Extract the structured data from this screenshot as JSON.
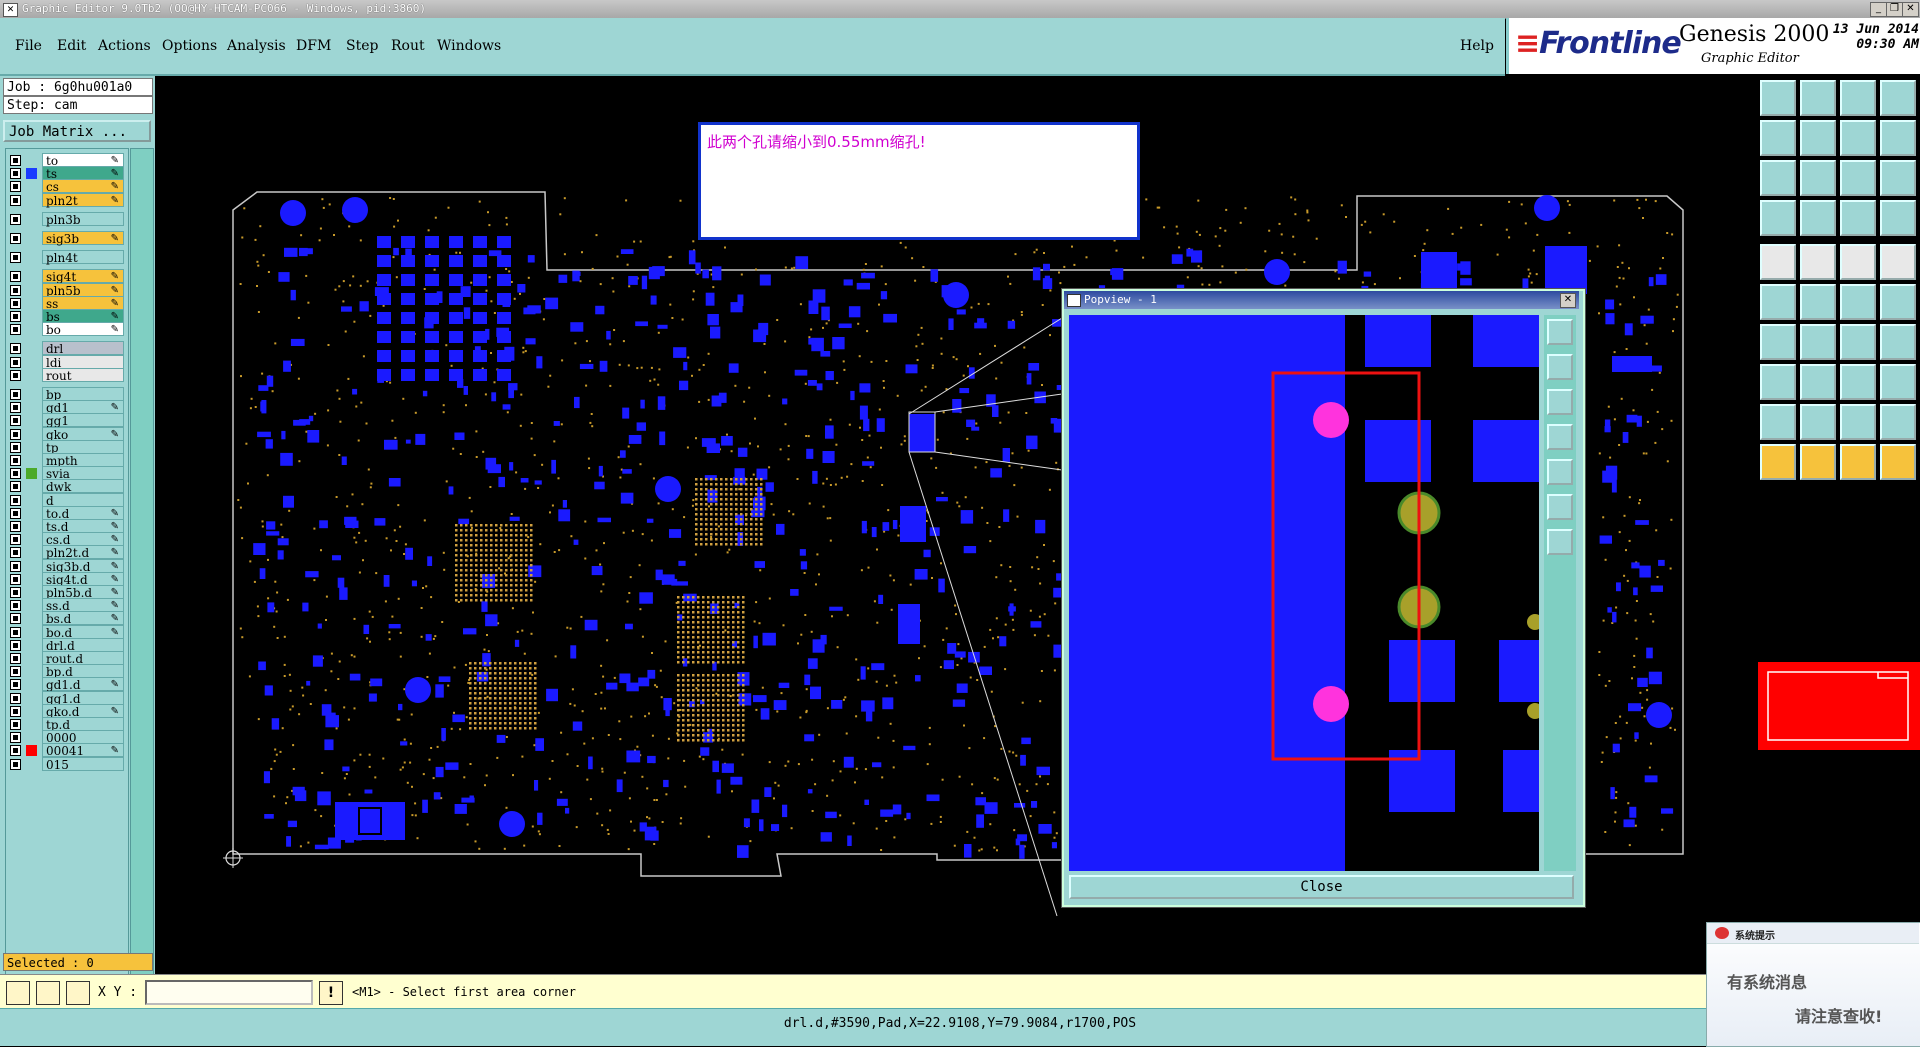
{
  "window": {
    "title": "Graphic Editor 9.0Tb2 (OO@HY-HTCAM-PC066 - Windows, pid:3860)"
  },
  "menu": {
    "items": [
      "File",
      "Edit",
      "Actions",
      "Options",
      "Analysis",
      "DFM",
      "Step",
      "Rout",
      "Windows"
    ],
    "help": "Help"
  },
  "brand": {
    "logo": "Frontline",
    "product": "Genesis 2000",
    "subtitle": "Graphic Editor",
    "date": "13 Jun 2014",
    "time": "09:30 AM"
  },
  "job": {
    "job_label": "Job : 6g0hu001a0",
    "step_label": "Step: cam",
    "matrix_button": "Job Matrix ..."
  },
  "layers": [
    {
      "name": "to",
      "bg": "#ffffff",
      "swatch": "",
      "pen": true
    },
    {
      "name": "ts",
      "bg": "#3fa88c",
      "swatch": "#1a3cff",
      "pen": true
    },
    {
      "name": "cs",
      "bg": "#f6c23c",
      "swatch": "",
      "pen": true
    },
    {
      "name": "pln2t",
      "bg": "#f6c23c",
      "swatch": "",
      "pen": true
    },
    {
      "name": "pln3b",
      "bg": "#9ed6d4",
      "swatch": "",
      "pen": false
    },
    {
      "name": "sig3b",
      "bg": "#f6c23c",
      "swatch": "",
      "pen": true
    },
    {
      "name": "pln4t",
      "bg": "#9ed6d4",
      "swatch": "",
      "pen": false
    },
    {
      "name": "sig4t",
      "bg": "#f6c23c",
      "swatch": "",
      "pen": true
    },
    {
      "name": "pln5b",
      "bg": "#f6c23c",
      "swatch": "",
      "pen": true
    },
    {
      "name": "ss",
      "bg": "#f6c23c",
      "swatch": "",
      "pen": true
    },
    {
      "name": "bs",
      "bg": "#3fa88c",
      "swatch": "",
      "pen": true
    },
    {
      "name": "bo",
      "bg": "#ffffff",
      "swatch": "",
      "pen": true
    },
    {
      "name": "drl",
      "bg": "#b8c0cc",
      "swatch": "",
      "pen": false
    },
    {
      "name": "ldi",
      "bg": "#e8e8e8",
      "swatch": "",
      "pen": false
    },
    {
      "name": "rout",
      "bg": "#e8e8e8",
      "swatch": "",
      "pen": false
    },
    {
      "name": "bp",
      "bg": "#9ed6d4",
      "swatch": "",
      "pen": false
    },
    {
      "name": "gd1",
      "bg": "#9ed6d4",
      "swatch": "",
      "pen": true
    },
    {
      "name": "gg1",
      "bg": "#9ed6d4",
      "swatch": "",
      "pen": false
    },
    {
      "name": "gko",
      "bg": "#9ed6d4",
      "swatch": "",
      "pen": true
    },
    {
      "name": "tp",
      "bg": "#9ed6d4",
      "swatch": "",
      "pen": false
    },
    {
      "name": "mpth",
      "bg": "#9ed6d4",
      "swatch": "",
      "pen": false
    },
    {
      "name": "svia",
      "bg": "#9ed6d4",
      "swatch": "#4caa2a",
      "pen": false
    },
    {
      "name": "dwk",
      "bg": "#9ed6d4",
      "swatch": "",
      "pen": false
    },
    {
      "name": "d",
      "bg": "#9ed6d4",
      "swatch": "",
      "pen": false
    },
    {
      "name": "to.d",
      "bg": "#9ed6d4",
      "swatch": "",
      "pen": true
    },
    {
      "name": "ts.d",
      "bg": "#9ed6d4",
      "swatch": "",
      "pen": true
    },
    {
      "name": "cs.d",
      "bg": "#9ed6d4",
      "swatch": "",
      "pen": true
    },
    {
      "name": "pln2t.d",
      "bg": "#9ed6d4",
      "swatch": "",
      "pen": true
    },
    {
      "name": "sig3b.d",
      "bg": "#9ed6d4",
      "swatch": "",
      "pen": true
    },
    {
      "name": "sig4t.d",
      "bg": "#9ed6d4",
      "swatch": "",
      "pen": true
    },
    {
      "name": "pln5b.d",
      "bg": "#9ed6d4",
      "swatch": "",
      "pen": true
    },
    {
      "name": "ss.d",
      "bg": "#9ed6d4",
      "swatch": "",
      "pen": true
    },
    {
      "name": "bs.d",
      "bg": "#9ed6d4",
      "swatch": "",
      "pen": true
    },
    {
      "name": "bo.d",
      "bg": "#9ed6d4",
      "swatch": "",
      "pen": true
    },
    {
      "name": "drl.d",
      "bg": "#9ed6d4",
      "swatch": "",
      "pen": false
    },
    {
      "name": "rout.d",
      "bg": "#9ed6d4",
      "swatch": "",
      "pen": false
    },
    {
      "name": "bp.d",
      "bg": "#9ed6d4",
      "swatch": "",
      "pen": false
    },
    {
      "name": "gd1.d",
      "bg": "#9ed6d4",
      "swatch": "",
      "pen": true
    },
    {
      "name": "gg1.d",
      "bg": "#9ed6d4",
      "swatch": "",
      "pen": false
    },
    {
      "name": "gko.d",
      "bg": "#9ed6d4",
      "swatch": "",
      "pen": true
    },
    {
      "name": "tp.d",
      "bg": "#9ed6d4",
      "swatch": "",
      "pen": false
    },
    {
      "name": "0000",
      "bg": "#9ed6d4",
      "swatch": "",
      "pen": false
    },
    {
      "name": "00041",
      "bg": "#9ed6d4",
      "swatch": "#ff0000",
      "pen": true
    },
    {
      "name": "015",
      "bg": "#9ed6d4",
      "swatch": "",
      "pen": false
    }
  ],
  "selected_label": "Selected : 0",
  "message": "此两个孔请缩小到0.55mm缩孔!",
  "popview": {
    "title": "Popview - 1",
    "close_label": "Close"
  },
  "bottom": {
    "xy_label": "X Y :",
    "xy_value": "",
    "prompt": "<M1> - Select first area corner"
  },
  "status": {
    "text": "drl.d,#3590,Pad,X=22.9108,Y=79.9084,r1700,POS"
  },
  "notification": {
    "header": "系统提示",
    "line1": "有系统消息",
    "line2": "请注意查收!"
  },
  "colors": {
    "pad_blue": "#1a1aff",
    "drill_magenta": "#ff33dd",
    "via_olive": "#a8a02a",
    "highlight_red": "#ee1111",
    "panel_teal": "#9ed6d4"
  }
}
